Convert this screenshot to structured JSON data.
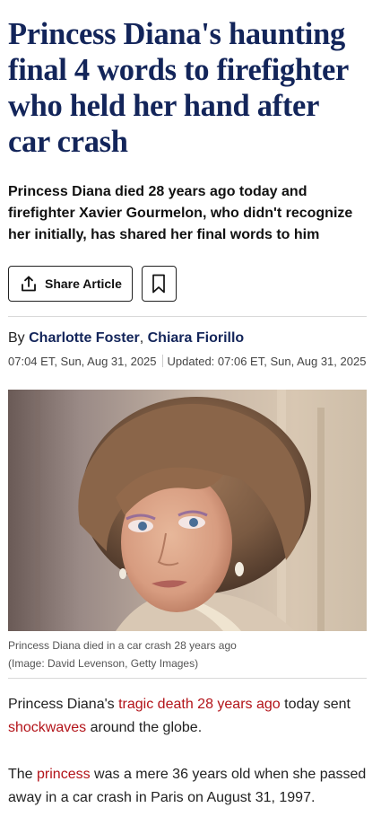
{
  "headline": "Princess Diana's haunting final 4 words to firefighter who held her hand after car crash",
  "standfirst": "Princess Diana died 28 years ago today and firefighter Xavier Gourmelon, who didn't recognize her initially, has shared her final words to him",
  "actions": {
    "share_label": "Share Article",
    "share_icon": "share-icon",
    "bookmark_icon": "bookmark-icon"
  },
  "byline": {
    "prefix": "By",
    "author1": "Charlotte Foster",
    "separator": ",",
    "author2": "Chiara Fiorillo"
  },
  "dates": {
    "published": "07:04 ET, Sun, Aug 31, 2025",
    "updated": "Updated: 07:06 ET, Sun, Aug 31, 2025"
  },
  "image": {
    "caption": "Princess Diana died in a car crash 28 years ago",
    "credit": "(Image: David Levenson, Getty Images)"
  },
  "body": {
    "p1": {
      "t1": "Princess Diana's ",
      "l1": "tragic death 28 years ago",
      "t2": " today sent ",
      "l2": "shockwaves",
      "t3": " around the globe."
    },
    "p2": {
      "t1": "The ",
      "l1": "princess",
      "t2": " was a mere 36 years old when she passed away in a car crash in Paris on August 31, 1997."
    }
  },
  "colors": {
    "headline": "#13255a",
    "link": "#b3141a",
    "author": "#13255a"
  }
}
